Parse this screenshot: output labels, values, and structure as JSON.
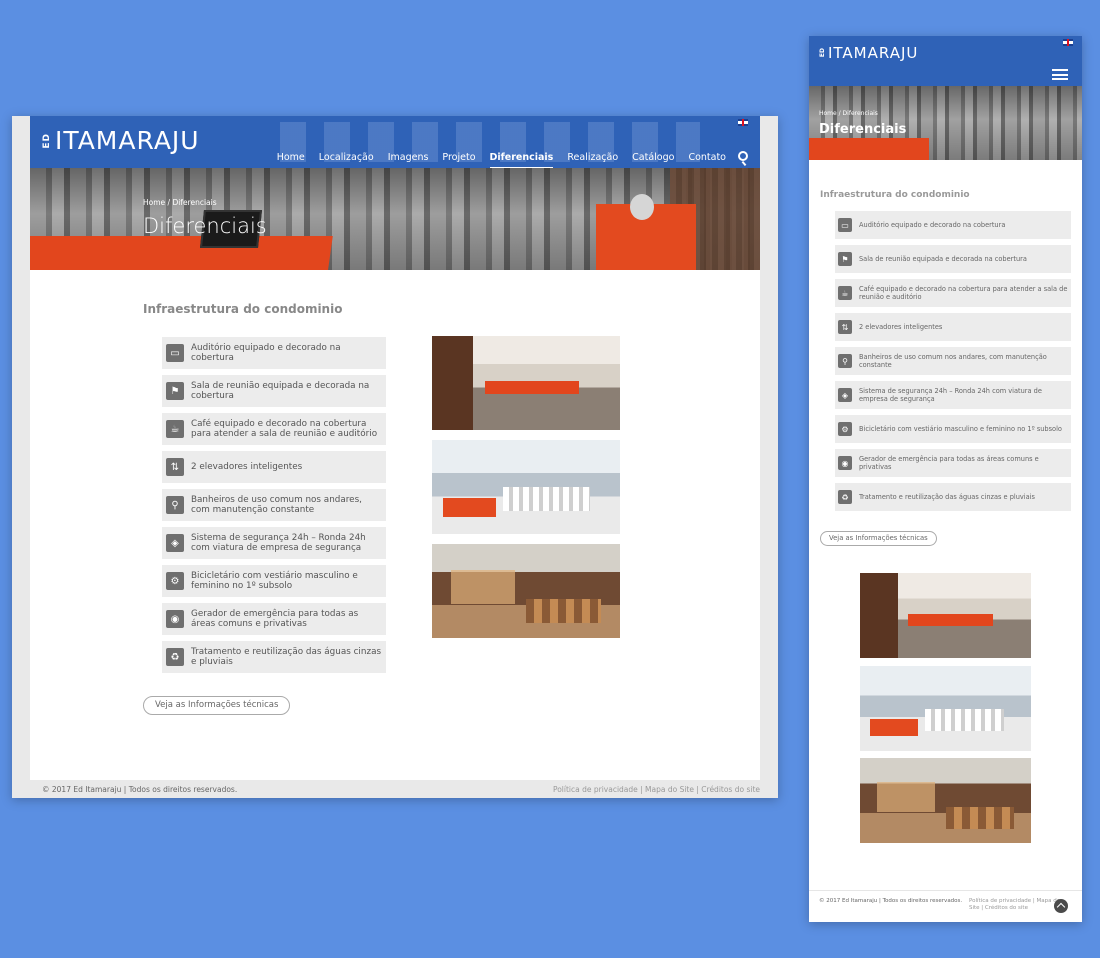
{
  "site": {
    "logo_prefix": "ED",
    "logo_name": "ITAMARAJU"
  },
  "nav": {
    "items": [
      {
        "label": "Home",
        "active": false
      },
      {
        "label": "Localização",
        "active": false
      },
      {
        "label": "Imagens",
        "active": false
      },
      {
        "label": "Projeto",
        "active": false
      },
      {
        "label": "Diferenciais",
        "active": true
      },
      {
        "label": "Realização",
        "active": false
      },
      {
        "label": "Catálogo",
        "active": false
      },
      {
        "label": "Contato",
        "active": false
      }
    ]
  },
  "hero": {
    "breadcrumb": "Home / Diferenciais",
    "title": "Diferenciais"
  },
  "section": {
    "title": "Infraestrutura do condominio"
  },
  "features": [
    {
      "icon": "auditorium-icon",
      "glyph": "▭",
      "text": "Auditório equipado e decorado na cobertura"
    },
    {
      "icon": "meeting-room-icon",
      "glyph": "⚑",
      "text": "Sala de reunião equipada e decorada na cobertura"
    },
    {
      "icon": "cafe-icon",
      "glyph": "☕",
      "text": "Café equipado e decorado na cobertura para atender a sala de reunião e auditório"
    },
    {
      "icon": "elevator-icon",
      "glyph": "⇅",
      "text": "2 elevadores inteligentes"
    },
    {
      "icon": "restroom-icon",
      "glyph": "⚲",
      "text": "Banheiros de uso comum nos andares, com manutenção constante"
    },
    {
      "icon": "security-shield-icon",
      "glyph": "◈",
      "text": "Sistema de segurança 24h – Ronda 24h com viatura de empresa de segurança"
    },
    {
      "icon": "bicycle-icon",
      "glyph": "⚙",
      "text": "Bicicletário com vestiário masculino e feminino no 1º subsolo"
    },
    {
      "icon": "generator-eye-icon",
      "glyph": "◉",
      "text": "Gerador de emergência para todas as áreas comuns e privativas"
    },
    {
      "icon": "recycle-icon",
      "glyph": "♻",
      "text": "Tratamento e reutilização das águas cinzas e pluviais"
    }
  ],
  "cta": {
    "label": "Veja as Informações técnicas"
  },
  "footer": {
    "copyright": "© 2017 Ed Itamaraju | Todos os direitos reservados.",
    "links_desktop": "Política de privacidade | Mapa do Site | Créditos do site",
    "links_mobile": "Política de privacidade | Mapa do Site | Créditos do site"
  },
  "colors": {
    "header_blue": "#2f62b7",
    "background_blue": "#5b8fe2",
    "accent_orange": "#e2461d",
    "item_bg": "#ececec"
  }
}
